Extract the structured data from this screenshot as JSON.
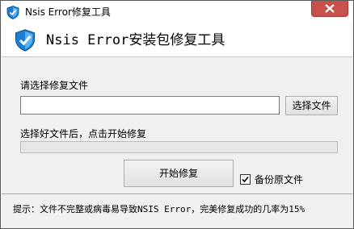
{
  "window": {
    "title": "Nsis Error修复工具",
    "close_icon": "close-icon"
  },
  "header": {
    "heading": "Nsis Error安装包修复工具",
    "icon": "shield-icon"
  },
  "main": {
    "select_label": "请选择修复文件",
    "file_input": {
      "value": "",
      "placeholder": ""
    },
    "choose_button": "选择文件",
    "hint": "选择好文件后，点击开始修复",
    "progress": 0,
    "start_button": "开始修复",
    "backup_checkbox": {
      "label": "备份原文件",
      "checked": true
    }
  },
  "status_bar": {
    "text": "提示：文件不完整或病毒易导致NSIS Error，完美修复成功的几率为15%"
  },
  "colors": {
    "shield": "#1a7fd4",
    "close_button": "#c7504a",
    "window_bg": "#f0f0f0"
  }
}
